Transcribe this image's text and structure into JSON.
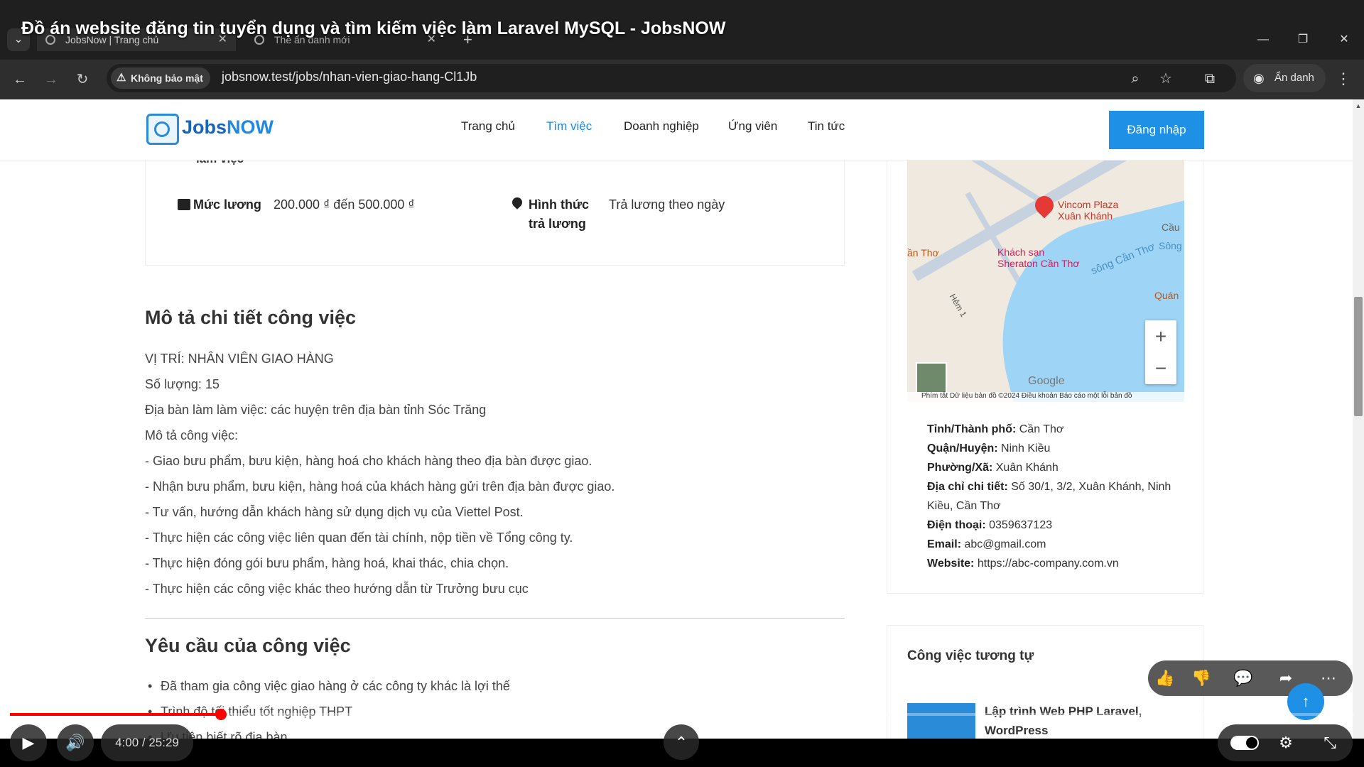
{
  "browser": {
    "tabs": [
      {
        "label": "JobsNow | Trang chủ",
        "active": true
      },
      {
        "label": "Thẻ ẩn danh mới",
        "active": false
      }
    ],
    "security_label": "Không bảo mật",
    "url": "jobsnow.test/jobs/nhan-vien-giao-hang-Cl1Jb",
    "incognito_label": "Ẩn danh"
  },
  "video": {
    "title": "Đồ án website đăng tin tuyển dụng và tìm kiếm việc làm Laravel MySQL - JobsNOW",
    "time": "4:00 / 25:29",
    "progress": 0.157
  },
  "site": {
    "logo_main": "Jobs",
    "logo_accent": "NOW",
    "nav": [
      "Trang chủ",
      "Tìm việc",
      "Doanh nghiệp",
      "Ứng viên",
      "Tin tức"
    ],
    "active_nav": "Tìm việc",
    "login": "Đăng nhập"
  },
  "job": {
    "partial_label": "làm việc",
    "salary_label": "Mức lương",
    "salary_value": "200.000 ₫ đến 500.000 ₫",
    "payment_label_1": "Hình thức",
    "payment_label_2": "trả lương",
    "payment_value": "Trả lương theo ngày",
    "desc_title": "Mô tả chi tiết công việc",
    "desc_lines": [
      "VỊ TRÍ: NHÂN VIÊN GIAO HÀNG",
      "Số lượng: 15",
      "Địa bàn làm làm việc: các huyện trên địa bàn tỉnh Sóc Trăng",
      "Mô tả công việc:",
      "- Giao bưu phẩm, bưu kiện, hàng hoá cho khách hàng theo địa bàn được giao.",
      "- Nhận bưu phẩm, bưu kiện, hàng hoá của khách hàng gửi trên địa bàn được giao.",
      "- Tư vấn, hướng dẫn khách hàng sử dụng dịch vụ của Viettel Post.",
      "- Thực hiện các công việc liên quan đến tài chính, nộp tiền về Tổng công ty.",
      "- Thực hiện đóng gói bưu phẩm, hàng hoá, khai thác, chia chọn.",
      "- Thực hiện các công việc khác theo hướng dẫn từ Trưởng bưu cục"
    ],
    "req_title": "Yêu cầu của công việc",
    "req_items": [
      "Đã tham gia công việc giao hàng ở các công ty khác là lợi thế",
      "Trình độ tối thiểu tốt nghiệp THPT",
      "Ưu tiên biết rõ địa bàn"
    ]
  },
  "map": {
    "poi1": "Vincom Plaza",
    "poi2": "Xuân Khánh",
    "poi3": "Khách sạn",
    "poi4": "Sheraton Cần Thơ",
    "river": "sông Cần Thơ",
    "city": "ần Thơ",
    "song": "Sông",
    "cau": "Cầu",
    "quan": "Quán",
    "hem": "Hẻm 1",
    "google": "Google",
    "attrib": "Phím tắt   Dữ liệu bản đồ ©2024   Điều khoản   Báo cáo một lỗi bản đồ"
  },
  "contact": {
    "city_label": "Tỉnh/Thành phố:",
    "city": "Cần Thơ",
    "district_label": "Quận/Huyện:",
    "district": "Ninh Kiều",
    "ward_label": "Phường/Xã:",
    "ward": "Xuân Khánh",
    "addr_label": "Địa chỉ chi tiết:",
    "addr_1": "Số 30/1, 3/2, Xuân Khánh, Ninh",
    "addr_2": "Kiều, Cần Thơ",
    "phone_label": "Điện thoại:",
    "phone": "0359637123",
    "email_label": "Email:",
    "email": "abc@gmail.com",
    "web_label": "Website:",
    "web": "https://abc-company.com.vn"
  },
  "similar": {
    "title": "Công việc tương tự",
    "job1": "Lập trình Web PHP Laravel, WordPress"
  }
}
